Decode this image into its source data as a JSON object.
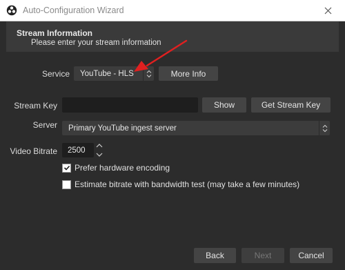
{
  "window": {
    "title": "Auto-Configuration Wizard"
  },
  "header": {
    "title": "Stream Information",
    "subtitle": "Please enter your stream information"
  },
  "service": {
    "label": "Service",
    "value": "YouTube - HLS",
    "more_info_label": "More Info"
  },
  "stream_key": {
    "label": "Stream Key",
    "value": "",
    "show_label": "Show",
    "get_key_label": "Get Stream Key"
  },
  "server": {
    "label": "Server",
    "value": "Primary YouTube ingest server"
  },
  "bitrate": {
    "label": "Video Bitrate",
    "value": "2500"
  },
  "options": {
    "hardware_encoding": {
      "label": "Prefer hardware encoding",
      "checked": true
    },
    "bandwidth_test": {
      "label": "Estimate bitrate with bandwidth test (may take a few minutes)",
      "checked": false
    }
  },
  "footer": {
    "back_label": "Back",
    "next_label": "Next",
    "cancel_label": "Cancel"
  },
  "colors": {
    "background": "#2b2b2b",
    "annotation_arrow": "#e02020"
  }
}
